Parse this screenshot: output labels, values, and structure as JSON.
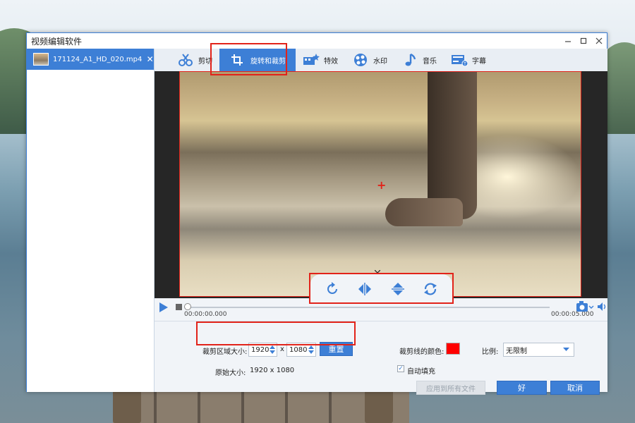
{
  "window": {
    "title": "视频编辑软件",
    "min_icon": "minimize-icon",
    "max_icon": "maximize-icon",
    "close_icon": "close-icon"
  },
  "sidebar": {
    "file_name": "171124_A1_HD_020.mp4",
    "close_glyph": "✕"
  },
  "toolbar": {
    "tools": [
      {
        "label": "剪切",
        "icon": "cut-icon"
      },
      {
        "label": "旋转和裁剪",
        "icon": "rotate-crop-icon"
      },
      {
        "label": "特效",
        "icon": "effects-icon"
      },
      {
        "label": "水印",
        "icon": "watermark-icon"
      },
      {
        "label": "音乐",
        "icon": "music-icon"
      },
      {
        "label": "字幕",
        "icon": "subtitle-icon"
      }
    ],
    "active": "旋转和裁剪"
  },
  "rotate_panel": {
    "buttons": [
      "rotate-clockwise-icon",
      "flip-horizontal-icon",
      "flip-vertical-icon",
      "rotate-cycle-icon"
    ]
  },
  "player": {
    "current_time": "00:00:00.000",
    "end_time": "00:00:05.000",
    "progress": 0.0
  },
  "crop": {
    "area_label": "裁剪区域大小:",
    "width": "1920",
    "x_sep": "x",
    "height": "1080",
    "reset_label": "重置",
    "original_label": "原始大小:",
    "original_value": "1920 x 1080",
    "line_color_label": "裁剪线的颜色:",
    "line_color": "#ff0000",
    "ratio_label": "比例:",
    "ratio_value": "无限制",
    "autofill_label": "自动填充",
    "autofill_checked": true
  },
  "footer": {
    "apply_all_label": "应用到所有文件",
    "ok_label": "好",
    "cancel_label": "取消"
  },
  "colors": {
    "accent": "#3d7fd6",
    "highlight": "#e2231a"
  }
}
